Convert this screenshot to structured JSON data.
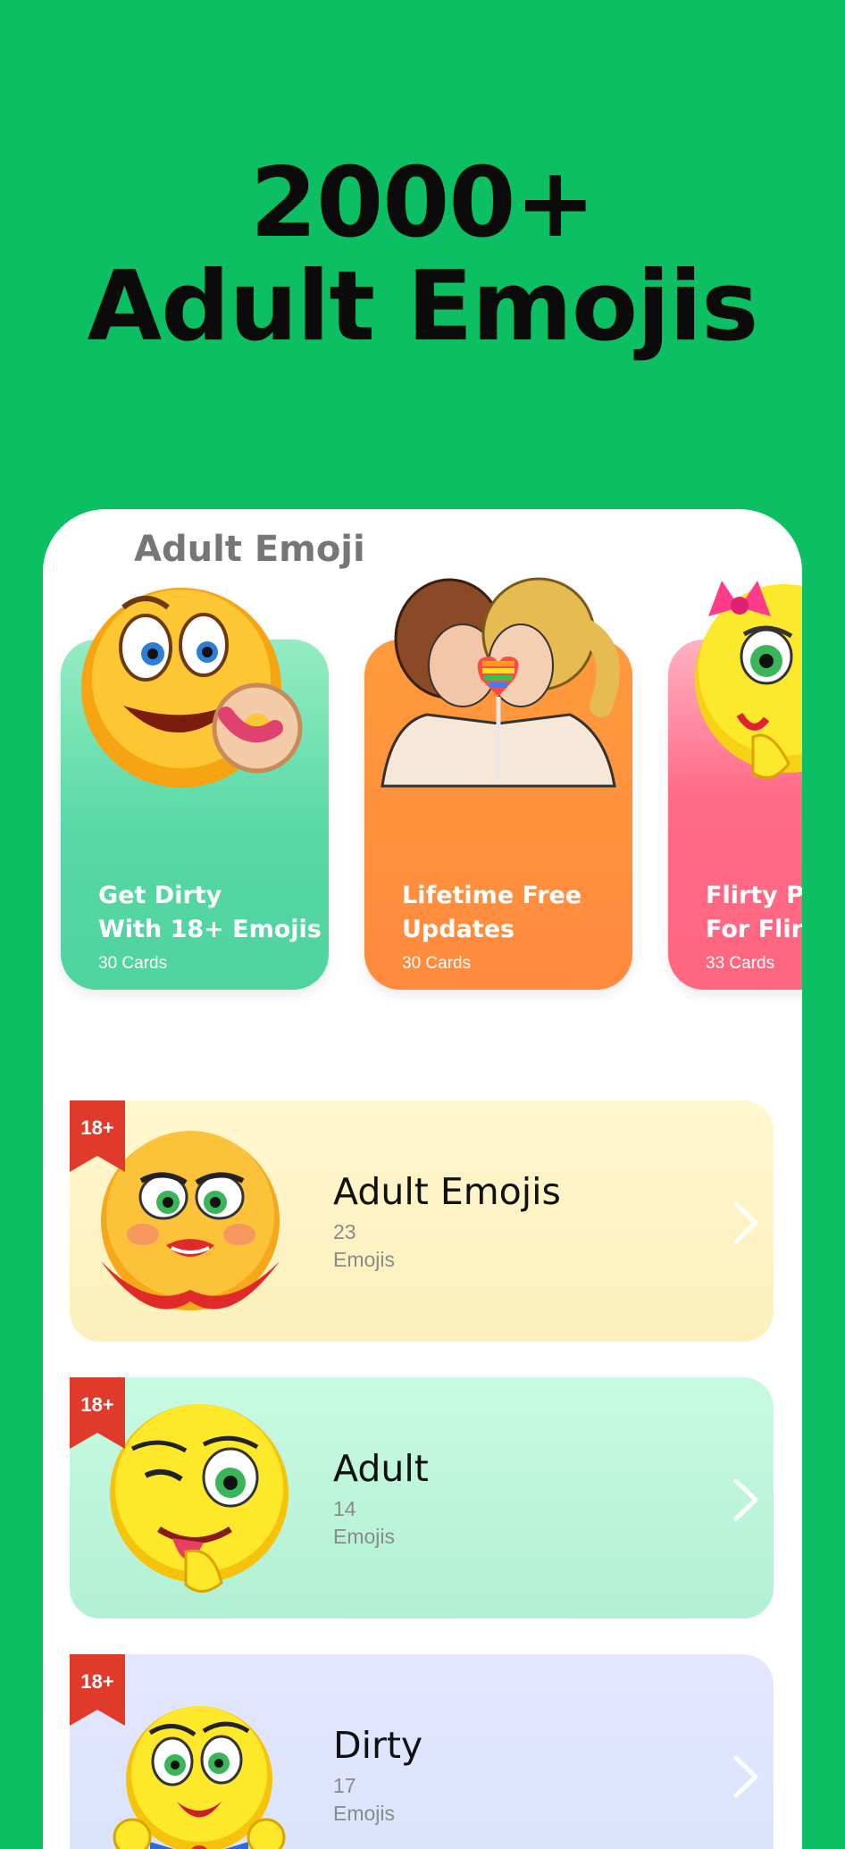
{
  "headline": {
    "line1": "2000+",
    "line2": "Adult Emojis"
  },
  "app": {
    "title": "Adult Emoji"
  },
  "cards": [
    {
      "title": "Get Dirty\nWith 18+ Emojis",
      "count": "30 Cards",
      "icon": "donut-emoji-icon"
    },
    {
      "title": "Lifetime Free\nUpdates",
      "count": "30 Cards",
      "icon": "kissing-women-icon"
    },
    {
      "title": "Flirty Pac\nFor Flirty",
      "count": "33 Cards",
      "icon": "flirty-girl-emoji-icon"
    }
  ],
  "packs": [
    {
      "badge": "18+",
      "title": "Adult Emojis",
      "count": "23\nEmojis",
      "icon": "lipstick-emoji-icon"
    },
    {
      "badge": "18+",
      "title": "Adult",
      "count": "14\nEmojis",
      "icon": "winking-tongue-emoji-icon"
    },
    {
      "badge": "18+",
      "title": "Dirty",
      "count": "17\nEmojis",
      "icon": "wink-bowtie-emoji-icon"
    }
  ],
  "colors": {
    "background": "#0cbf62",
    "badge": "#e03a2a"
  }
}
